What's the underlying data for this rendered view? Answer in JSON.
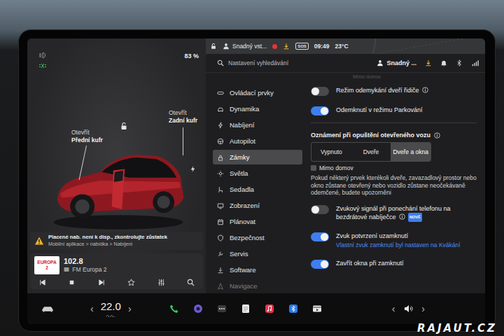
{
  "status": {
    "battery": "83 %",
    "profile": "Snadný vst...",
    "sos": "SOS",
    "time": "09:49",
    "temperature": "23°C"
  },
  "car": {
    "front": {
      "action": "Otevřít",
      "label": "Přední kufr"
    },
    "rear": {
      "action": "Otevřít",
      "label": "Zadní kufr"
    },
    "locked": false
  },
  "alert": {
    "title": "Placené nab. není k disp., zkontrolujte zůstatek",
    "path": "Mobilní aplikace > nabídka > Nabíjení"
  },
  "media": {
    "logo": "EUROPA 2",
    "frequency": "102.8",
    "station": "FM Europa 2"
  },
  "header": {
    "search_placeholder": "Nastavení vyhledávání",
    "profile": "Snadný ..."
  },
  "sidebar": [
    {
      "label": "Ovládací prvky",
      "selected": false
    },
    {
      "label": "Dynamika",
      "selected": false
    },
    {
      "label": "Nabíjení",
      "selected": false
    },
    {
      "label": "Autopilot",
      "selected": false
    },
    {
      "label": "Zámky",
      "selected": true
    },
    {
      "label": "Světla",
      "selected": false
    },
    {
      "label": "Sedadla",
      "selected": false
    },
    {
      "label": "Zobrazení",
      "selected": false
    },
    {
      "label": "Plánovat",
      "selected": false
    },
    {
      "label": "Bezpečnost",
      "selected": false
    },
    {
      "label": "Servis",
      "selected": false
    },
    {
      "label": "Software",
      "selected": false
    },
    {
      "label": "Navigace",
      "selected": false
    }
  ],
  "settings": [
    {
      "kind": "faded",
      "label": "Mimo domov"
    },
    {
      "kind": "toggle",
      "label": "Režim odemykání dveří řidiče",
      "on": false,
      "info": true
    },
    {
      "kind": "toggle",
      "label": "Odemknutí v režimu Parkování",
      "on": true,
      "info": false
    },
    {
      "kind": "section",
      "label": "Oznámení při opuštění otevřeného vozu",
      "info": true
    },
    {
      "kind": "segmented",
      "options": [
        {
          "label": "Vypnuto",
          "selected": false
        },
        {
          "label": "Dveře",
          "selected": false
        },
        {
          "label": "Dveře a okna",
          "selected": true
        }
      ]
    },
    {
      "kind": "checkbox",
      "label": "Mimo domov",
      "checked": false
    },
    {
      "kind": "note",
      "label": "Pokud některý prvek kterékoli dveře, zavazadlový prostor nebo okno zůstane otevřený nebo vozidlo zůstane neočekávaně odemčené, budete upozorněni"
    },
    {
      "kind": "toggle",
      "label": "Zvukový signál při ponechání telefonu na bezdrátové nabíječce",
      "on": false,
      "info": true,
      "badge": "NOVÉ"
    },
    {
      "kind": "toggle",
      "label": "Zvuk potvrzení uzamknutí",
      "on": true,
      "info": false,
      "detail": "Vlastní zvuk zamknutí byl nastaven na Kvákání"
    },
    {
      "kind": "toggle",
      "label": "Zavřít okna při zamknutí",
      "on": true,
      "info": false
    }
  ],
  "climate": {
    "decrease": "‹",
    "temperature": "22.0",
    "increase": "›"
  },
  "volume": {
    "decrease": "‹",
    "increase": "›"
  },
  "watermark": "RAJAUT.CZ"
}
